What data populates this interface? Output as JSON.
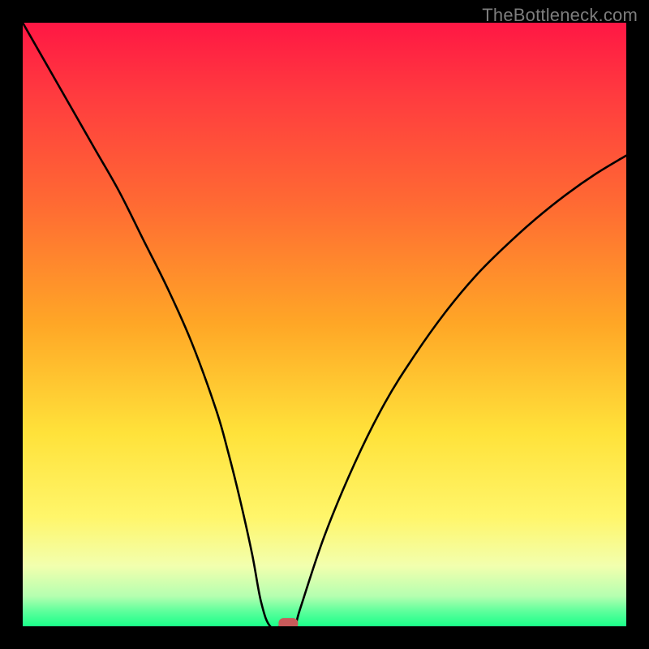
{
  "watermark": "TheBottleneck.com",
  "chart_data": {
    "type": "line",
    "title": "",
    "xlabel": "",
    "ylabel": "",
    "xlim": [
      0,
      100
    ],
    "ylim": [
      0,
      100
    ],
    "series": [
      {
        "name": "bottleneck-curve",
        "x": [
          0,
          4,
          8,
          12,
          16,
          20,
          24,
          28,
          32,
          34,
          36,
          38,
          39.5,
          41,
          43,
          45,
          46,
          50,
          55,
          60,
          65,
          70,
          75,
          80,
          85,
          90,
          95,
          100
        ],
        "y": [
          100,
          93,
          86,
          79,
          72,
          64,
          56,
          47,
          36,
          29,
          21,
          12,
          4,
          0,
          0,
          0,
          3,
          15,
          27,
          37,
          45,
          52,
          58,
          63,
          67.5,
          71.5,
          75,
          78
        ]
      }
    ],
    "marker": {
      "x": 44,
      "y": 0,
      "color": "#c85a5a"
    },
    "background_gradient": {
      "stops": [
        {
          "offset": 0.0,
          "color": "#ff1744"
        },
        {
          "offset": 0.12,
          "color": "#ff3b3f"
        },
        {
          "offset": 0.3,
          "color": "#ff6a33"
        },
        {
          "offset": 0.5,
          "color": "#ffa726"
        },
        {
          "offset": 0.68,
          "color": "#ffe23a"
        },
        {
          "offset": 0.82,
          "color": "#fff66b"
        },
        {
          "offset": 0.9,
          "color": "#f2ffae"
        },
        {
          "offset": 0.95,
          "color": "#b5ffb0"
        },
        {
          "offset": 0.975,
          "color": "#5eff9c"
        },
        {
          "offset": 1.0,
          "color": "#1aff89"
        }
      ]
    }
  }
}
